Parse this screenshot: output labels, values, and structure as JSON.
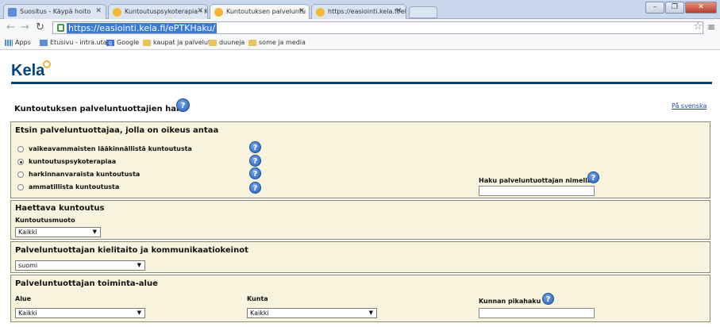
{
  "browser": {
    "tabs": [
      {
        "label": "Suositus - Käypä hoito",
        "icon": "page-icon"
      },
      {
        "label": "Kuntoutuspsykoterapia - K",
        "icon": "kela-icon"
      },
      {
        "label": "Kuntoutuksen palveluntu",
        "icon": "kela-icon"
      },
      {
        "label": "https://easiointi.kela.fi/eP",
        "icon": "kela-icon"
      }
    ],
    "active_tab": 2,
    "url": "https://easiointi.kela.fi/ePTKHaku/",
    "bookmarks": [
      {
        "label": "Apps",
        "icon": "apps-icon"
      },
      {
        "label": "Etusivu - intra.uta",
        "icon": "page-icon"
      },
      {
        "label": "Google",
        "icon": "google-icon"
      },
      {
        "label": "kaupat ja palvelut",
        "icon": "folder-icon"
      },
      {
        "label": "duuneja",
        "icon": "folder-icon"
      },
      {
        "label": "some ja media",
        "icon": "folder-icon"
      }
    ]
  },
  "logo": {
    "text": "Kela"
  },
  "page": {
    "title": "Kuntoutuksen palveluntuottajien haku",
    "language_link": "På svenska",
    "help_glyph": "?"
  },
  "provider_type": {
    "title": "Etsin palveluntuottajaa, jolla on oikeus antaa",
    "options": [
      {
        "label": "vaikeavammaisten lääkinnällistä kuntoutusta",
        "selected": false
      },
      {
        "label": "kuntoutuspsykoterapiaa",
        "selected": true
      },
      {
        "label": "harkinnanvaraista kuntoutusta",
        "selected": false
      },
      {
        "label": "ammatillista kuntoutusta",
        "selected": false
      }
    ],
    "name_search_label": "Haku palveluntuottajan nimellä",
    "name_search_value": ""
  },
  "rehab": {
    "title": "Haettava kuntoutus",
    "field_label": "Kuntoutusmuoto",
    "selected": "Kaikki"
  },
  "language": {
    "title": "Palveluntuottajan kielitaito ja kommunikaatiokeinot",
    "selected": "suomi"
  },
  "area": {
    "title": "Palveluntuottajan toiminta-alue",
    "region_label": "Alue",
    "region_selected": "Kaikki",
    "municipality_label": "Kunta",
    "municipality_selected": "Kaikki",
    "quick_search_label": "Kunnan pikahaku",
    "quick_search_value": ""
  }
}
